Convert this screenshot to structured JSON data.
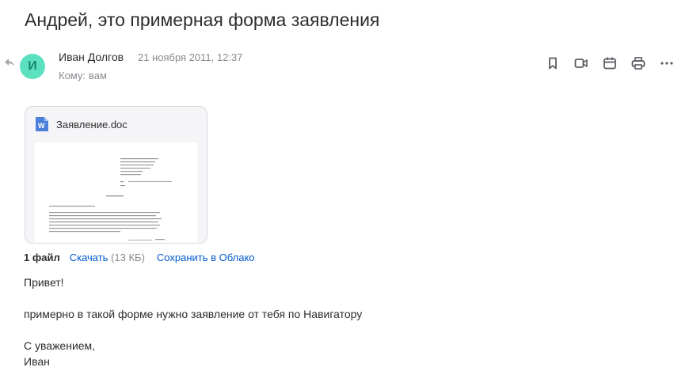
{
  "subject": "Андрей, это примерная форма заявления",
  "sender": {
    "avatar_letter": "И",
    "name": "Иван Долгов",
    "date": "21 ноября 2011, 12:37",
    "to_label": "Кому:",
    "to_value": "вам"
  },
  "actions": [
    "bookmark-icon",
    "video-icon",
    "calendar-icon",
    "print-icon",
    "more-icon"
  ],
  "attachment": {
    "file_name": "Заявление.doc",
    "count_label": "1 файл",
    "download_label": "Скачать",
    "size": "(13 КБ)",
    "save_cloud_label": "Сохранить в Облако"
  },
  "body": {
    "greeting": "Привет!",
    "line1": "примерно в такой форме нужно заявление от тебя по Навигатору",
    "closing1": "С уважением,",
    "closing2": "Иван"
  },
  "colors": {
    "avatar_bg": "#5be1c0",
    "link": "#005bd1",
    "muted": "#87898f",
    "word_blue": "#4a80d9"
  }
}
